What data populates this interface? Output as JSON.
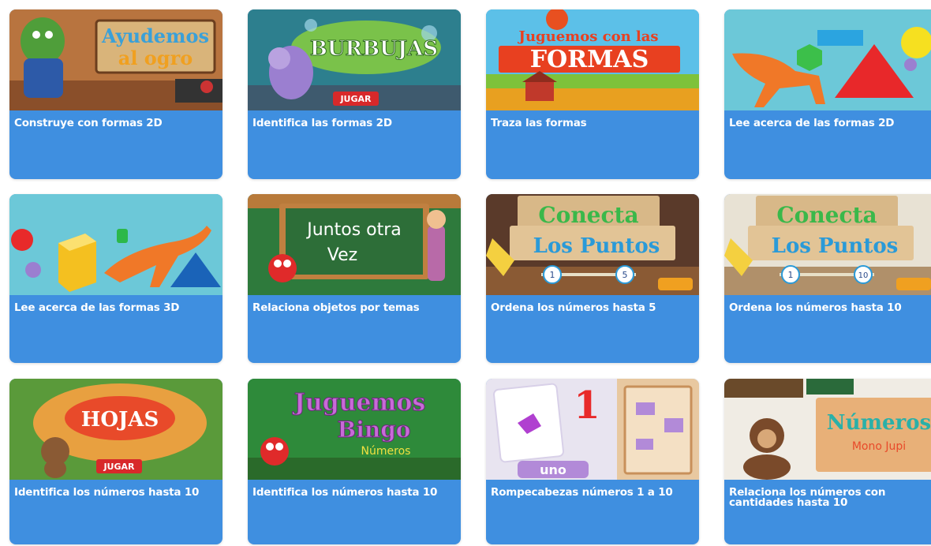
{
  "games": [
    {
      "caption": "Construye con formas 2D",
      "art_title_1": "Ayudemos",
      "art_title_2": "al ogro"
    },
    {
      "caption": "Identifica las formas 2D",
      "art_title_1": "BURBUJAS",
      "art_button": "JUGAR"
    },
    {
      "caption": "Traza las formas",
      "art_title_1": "Juguemos con las",
      "art_title_2": "FORMAS"
    },
    {
      "caption": "Lee acerca de las formas 2D"
    },
    {
      "caption": "Lee acerca de las formas 3D"
    },
    {
      "caption": "Relaciona objetos por temas",
      "art_title_1": "Juntos otra",
      "art_title_2": "Vez"
    },
    {
      "caption": "Ordena los números hasta 5",
      "art_title_1": "Conecta",
      "art_title_2": "Los Puntos",
      "art_n1": "1",
      "art_n2": "5"
    },
    {
      "caption": "Ordena los números hasta 10",
      "art_title_1": "Conecta",
      "art_title_2": "Los Puntos",
      "art_n1": "1",
      "art_n2": "10"
    },
    {
      "caption": "Identifica los números hasta 10",
      "art_title_1": "HOJAS",
      "art_button": "JUGAR"
    },
    {
      "caption": "Identifica los números hasta 10",
      "art_title_1": "Juguemos",
      "art_title_2": "Bingo",
      "art_title_3": "Números"
    },
    {
      "caption": "Rompecabezas números 1 a 10",
      "art_title_1": "1",
      "art_title_2": "uno"
    },
    {
      "caption": "Relaciona los números con cantidades hasta 10",
      "art_title_1": "Números",
      "art_title_2": "Mono Jupi"
    }
  ]
}
